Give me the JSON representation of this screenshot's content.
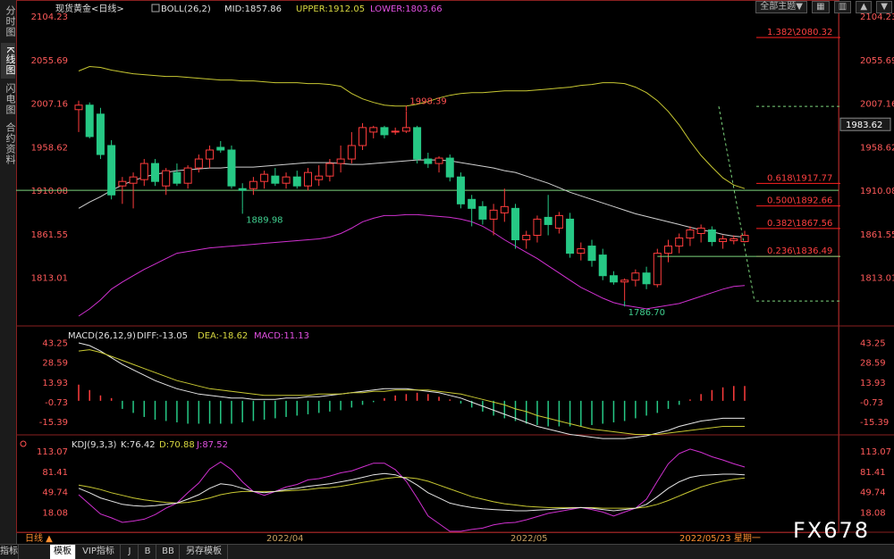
{
  "sidebar": {
    "tabs": [
      "分时图",
      "K线图",
      "闪电图",
      "合约资料"
    ],
    "active": 1
  },
  "toolbar": {
    "theme_label": "全部主题▼",
    "icons": [
      "grid-icon",
      "layout-icon",
      "chevron-up-icon",
      "chevron-down-icon"
    ]
  },
  "header": {
    "main": {
      "instrument": "现货黄金<日线>",
      "boll": "BOLL(26,2)",
      "mid": "MID:1857.86",
      "upper": "UPPER:1912.05",
      "lower": "LOWER:1803.66"
    },
    "macd": {
      "name": "MACD(26,12,9)",
      "diff": "DIFF:-13.05",
      "dea": "DEA:-18.62",
      "macd": "MACD:11.13"
    },
    "kdj": {
      "name": "KDJ(9,3,3)",
      "k": "K:76.42",
      "d": "D:70.88",
      "j": "J:87.52"
    }
  },
  "current_price": "1983.62",
  "watermark": "FX678",
  "bottom": {
    "period": "日线 ▲",
    "tabs": [
      "指标",
      "模板",
      "VIP指标",
      "J",
      "B",
      "BB",
      "另存模板"
    ],
    "active": 1
  },
  "colors": {
    "up": "#ff3c3c",
    "down": "#26c885",
    "mid": "#d0d0d0",
    "upper": "#c8c832",
    "lower": "#d030d0",
    "fib": "#ff2020",
    "hline": "#7cd47c"
  },
  "chart_data": [
    {
      "type": "candlestick",
      "title": "现货黄金<日线>",
      "y_ticks": [
        "2104.23",
        "2055.69",
        "2007.16",
        "1958.62",
        "1910.08",
        "1861.55",
        "1813.01"
      ],
      "x_ticks": [
        "2022/04",
        "2022/05",
        "2022/05/23 星期一"
      ],
      "ylim": [
        1764,
        2104.23
      ],
      "horizontal_line": 1910.08,
      "candles": [
        {
          "o": 2000,
          "h": 2010,
          "l": 1975,
          "c": 2005
        },
        {
          "o": 2005,
          "h": 2008,
          "l": 1968,
          "c": 1970
        },
        {
          "o": 1995,
          "h": 2002,
          "l": 1945,
          "c": 1950
        },
        {
          "o": 1960,
          "h": 1966,
          "l": 1900,
          "c": 1905
        },
        {
          "o": 1915,
          "h": 1925,
          "l": 1895,
          "c": 1920
        },
        {
          "o": 1918,
          "h": 1930,
          "l": 1890,
          "c": 1925
        },
        {
          "o": 1922,
          "h": 1945,
          "l": 1915,
          "c": 1940
        },
        {
          "o": 1940,
          "h": 1945,
          "l": 1915,
          "c": 1920
        },
        {
          "o": 1915,
          "h": 1935,
          "l": 1905,
          "c": 1932
        },
        {
          "o": 1930,
          "h": 1940,
          "l": 1915,
          "c": 1918
        },
        {
          "o": 1918,
          "h": 1938,
          "l": 1912,
          "c": 1935
        },
        {
          "o": 1935,
          "h": 1950,
          "l": 1930,
          "c": 1945
        },
        {
          "o": 1945,
          "h": 1960,
          "l": 1935,
          "c": 1955
        },
        {
          "o": 1958,
          "h": 1965,
          "l": 1952,
          "c": 1955
        },
        {
          "o": 1955,
          "h": 1960,
          "l": 1912,
          "c": 1915
        },
        {
          "o": 1912,
          "h": 1918,
          "l": 1890,
          "c": 1910
        },
        {
          "o": 1912,
          "h": 1925,
          "l": 1905,
          "c": 1920
        },
        {
          "o": 1920,
          "h": 1932,
          "l": 1912,
          "c": 1928
        },
        {
          "o": 1926,
          "h": 1935,
          "l": 1915,
          "c": 1918
        },
        {
          "o": 1918,
          "h": 1930,
          "l": 1912,
          "c": 1925
        },
        {
          "o": 1925,
          "h": 1932,
          "l": 1912,
          "c": 1915
        },
        {
          "o": 1915,
          "h": 1935,
          "l": 1910,
          "c": 1930
        },
        {
          "o": 1922,
          "h": 1938,
          "l": 1915,
          "c": 1926
        },
        {
          "o": 1926,
          "h": 1945,
          "l": 1920,
          "c": 1940
        },
        {
          "o": 1940,
          "h": 1960,
          "l": 1930,
          "c": 1945
        },
        {
          "o": 1945,
          "h": 1975,
          "l": 1940,
          "c": 1960
        },
        {
          "o": 1960,
          "h": 1985,
          "l": 1955,
          "c": 1980
        },
        {
          "o": 1975,
          "h": 1982,
          "l": 1968,
          "c": 1980
        },
        {
          "o": 1980,
          "h": 1982,
          "l": 1968,
          "c": 1972
        },
        {
          "o": 1975,
          "h": 1980,
          "l": 1972,
          "c": 1976
        },
        {
          "o": 1976,
          "h": 1998,
          "l": 1974,
          "c": 1980
        },
        {
          "o": 1980,
          "h": 1982,
          "l": 1940,
          "c": 1945
        },
        {
          "o": 1945,
          "h": 1952,
          "l": 1935,
          "c": 1940
        },
        {
          "o": 1940,
          "h": 1948,
          "l": 1930,
          "c": 1946
        },
        {
          "o": 1946,
          "h": 1950,
          "l": 1920,
          "c": 1925
        },
        {
          "o": 1925,
          "h": 1930,
          "l": 1890,
          "c": 1895
        },
        {
          "o": 1900,
          "h": 1905,
          "l": 1870,
          "c": 1890
        },
        {
          "o": 1892,
          "h": 1898,
          "l": 1872,
          "c": 1878
        },
        {
          "o": 1878,
          "h": 1895,
          "l": 1860,
          "c": 1888
        },
        {
          "o": 1885,
          "h": 1912,
          "l": 1875,
          "c": 1892
        },
        {
          "o": 1890,
          "h": 1895,
          "l": 1845,
          "c": 1855
        },
        {
          "o": 1855,
          "h": 1865,
          "l": 1845,
          "c": 1860
        },
        {
          "o": 1860,
          "h": 1882,
          "l": 1852,
          "c": 1878
        },
        {
          "o": 1880,
          "h": 1905,
          "l": 1860,
          "c": 1872
        },
        {
          "o": 1868,
          "h": 1886,
          "l": 1862,
          "c": 1882
        },
        {
          "o": 1878,
          "h": 1885,
          "l": 1835,
          "c": 1840
        },
        {
          "o": 1840,
          "h": 1852,
          "l": 1832,
          "c": 1845
        },
        {
          "o": 1848,
          "h": 1855,
          "l": 1825,
          "c": 1832
        },
        {
          "o": 1838,
          "h": 1845,
          "l": 1810,
          "c": 1815
        },
        {
          "o": 1815,
          "h": 1820,
          "l": 1805,
          "c": 1808
        },
        {
          "o": 1808,
          "h": 1812,
          "l": 1787,
          "c": 1810
        },
        {
          "o": 1810,
          "h": 1822,
          "l": 1803,
          "c": 1818
        },
        {
          "o": 1818,
          "h": 1825,
          "l": 1800,
          "c": 1806
        },
        {
          "o": 1805,
          "h": 1845,
          "l": 1802,
          "c": 1840
        },
        {
          "o": 1840,
          "h": 1855,
          "l": 1830,
          "c": 1848
        },
        {
          "o": 1848,
          "h": 1862,
          "l": 1840,
          "c": 1857
        },
        {
          "o": 1857,
          "h": 1870,
          "l": 1848,
          "c": 1866
        },
        {
          "o": 1862,
          "h": 1872,
          "l": 1852,
          "c": 1868
        },
        {
          "o": 1866,
          "h": 1870,
          "l": 1848,
          "c": 1853
        },
        {
          "o": 1853,
          "h": 1860,
          "l": 1845,
          "c": 1856
        },
        {
          "o": 1854,
          "h": 1860,
          "l": 1850,
          "c": 1856
        },
        {
          "o": 1853,
          "h": 1865,
          "l": 1852,
          "c": 1860
        }
      ],
      "boll": {
        "mid": [
          1890,
          1897,
          1903,
          1910,
          1916,
          1921,
          1925,
          1928,
          1930,
          1932,
          1933,
          1934,
          1935,
          1935,
          1936,
          1936,
          1936,
          1937,
          1938,
          1939,
          1940,
          1941,
          1941,
          1941,
          1940,
          1939,
          1939,
          1940,
          1941,
          1942,
          1943,
          1944,
          1944,
          1944,
          1943,
          1941,
          1939,
          1937,
          1935,
          1932,
          1930,
          1926,
          1922,
          1918,
          1913,
          1908,
          1904,
          1900,
          1896,
          1892,
          1888,
          1884,
          1881,
          1878,
          1875,
          1872,
          1869,
          1866,
          1864,
          1861,
          1859,
          1858
        ],
        "upper": [
          2043,
          2048,
          2047,
          2044,
          2042,
          2040,
          2039,
          2038,
          2037,
          2037,
          2036,
          2035,
          2034,
          2033,
          2033,
          2032,
          2032,
          2031,
          2030,
          2030,
          2030,
          2029,
          2029,
          2028,
          2026,
          2018,
          2012,
          2008,
          2005,
          2004,
          2004,
          2006,
          2009,
          2013,
          2016,
          2018,
          2019,
          2019,
          2020,
          2021,
          2021,
          2021,
          2022,
          2023,
          2024,
          2025,
          2027,
          2028,
          2030,
          2030,
          2029,
          2025,
          2019,
          2010,
          1998,
          1983,
          1965,
          1949,
          1936,
          1924,
          1916,
          1912
        ],
        "lower": [
          1770,
          1778,
          1788,
          1800,
          1808,
          1815,
          1822,
          1828,
          1834,
          1840,
          1842,
          1844,
          1846,
          1847,
          1848,
          1849,
          1850,
          1851,
          1852,
          1853,
          1854,
          1855,
          1856,
          1858,
          1862,
          1868,
          1875,
          1879,
          1882,
          1882,
          1883,
          1883,
          1882,
          1881,
          1880,
          1878,
          1875,
          1870,
          1863,
          1855,
          1848,
          1841,
          1834,
          1826,
          1818,
          1810,
          1802,
          1796,
          1790,
          1785,
          1782,
          1780,
          1778,
          1780,
          1782,
          1784,
          1788,
          1792,
          1796,
          1800,
          1803,
          1804
        ]
      },
      "price_labels": [
        {
          "text": "1998.39",
          "index": 30,
          "value": 1998.39,
          "kind": "high"
        },
        {
          "text": "1889.98",
          "index": 15,
          "value": 1889.98,
          "kind": "low"
        },
        {
          "text": "1786.70",
          "index": 50,
          "value": 1786.7,
          "kind": "low"
        }
      ],
      "fibonacci": {
        "labels": [
          "1.382\\2080.32",
          "0.618\\1917.77",
          "0.500\\1892.66",
          "0.382\\1867.56",
          "0.236\\1836.49"
        ],
        "values": [
          2080.32,
          1917.77,
          1892.66,
          1867.56,
          1836.49
        ],
        "base_levels": [
          2003.65,
          1786.7
        ],
        "support_line": 1836.49
      }
    },
    {
      "type": "bar",
      "title": "MACD(26,12,9)",
      "y_ticks": [
        "43.25",
        "28.59",
        "13.93",
        "-0.73",
        "-15.39"
      ],
      "ylim": [
        -20,
        45
      ],
      "histogram": [
        12,
        8,
        4,
        2,
        -6,
        -9,
        -12,
        -14,
        -15,
        -16,
        -17,
        -17,
        -17,
        -17,
        -17,
        -16,
        -15,
        -14,
        -13,
        -12,
        -11,
        -10,
        -9,
        -8,
        -7,
        -5,
        -3,
        -1,
        2,
        4,
        5,
        6,
        5,
        3,
        1,
        -2,
        -5,
        -8,
        -11,
        -13,
        -15,
        -17,
        -18,
        -19,
        -19,
        -19,
        -19,
        -18,
        -17,
        -16,
        -15,
        -13,
        -11,
        -9,
        -6,
        -3,
        1,
        5,
        8,
        10,
        11,
        11
      ],
      "diff": [
        43,
        41,
        37,
        32,
        27,
        23,
        19,
        15,
        12,
        9,
        7,
        5,
        4,
        3,
        2,
        2,
        1,
        1,
        1,
        2,
        2,
        3,
        3,
        4,
        5,
        6,
        7,
        8,
        9,
        9,
        9,
        8,
        7,
        6,
        4,
        2,
        -1,
        -4,
        -7,
        -10,
        -13,
        -16,
        -19,
        -21,
        -23,
        -25,
        -26,
        -27,
        -28,
        -28,
        -28,
        -27,
        -26,
        -24,
        -22,
        -19,
        -17,
        -15,
        -14,
        -13,
        -13,
        -13
      ],
      "dea": [
        37,
        38,
        36,
        33,
        30,
        27,
        24,
        21,
        18,
        15,
        13,
        11,
        9,
        8,
        7,
        6,
        5,
        4,
        4,
        4,
        4,
        4,
        5,
        5,
        5,
        6,
        6,
        7,
        7,
        8,
        8,
        8,
        8,
        7,
        6,
        5,
        3,
        1,
        -1,
        -3,
        -6,
        -8,
        -11,
        -13,
        -15,
        -17,
        -19,
        -21,
        -22,
        -23,
        -24,
        -25,
        -25,
        -25,
        -24,
        -23,
        -22,
        -21,
        -20,
        -19,
        -19,
        -19
      ]
    },
    {
      "type": "line",
      "title": "KDJ(9,3,3)",
      "y_ticks": [
        "113.07",
        "81.41",
        "49.74",
        "18.08"
      ],
      "ylim": [
        -5,
        120
      ],
      "k": [
        55,
        48,
        40,
        35,
        30,
        28,
        27,
        28,
        30,
        32,
        38,
        45,
        55,
        62,
        60,
        55,
        50,
        48,
        50,
        53,
        55,
        58,
        60,
        62,
        65,
        68,
        72,
        76,
        78,
        76,
        70,
        60,
        48,
        40,
        32,
        28,
        25,
        23,
        22,
        21,
        20,
        20,
        21,
        22,
        23,
        24,
        25,
        24,
        22,
        20,
        22,
        24,
        30,
        42,
        55,
        65,
        72,
        75,
        76,
        77,
        77,
        76
      ],
      "d": [
        60,
        57,
        53,
        48,
        44,
        40,
        37,
        35,
        33,
        32,
        33,
        36,
        40,
        45,
        48,
        50,
        50,
        50,
        50,
        51,
        52,
        53,
        55,
        56,
        58,
        61,
        64,
        67,
        70,
        72,
        72,
        70,
        66,
        60,
        54,
        48,
        42,
        38,
        34,
        31,
        29,
        27,
        26,
        25,
        25,
        25,
        25,
        25,
        24,
        24,
        24,
        24,
        26,
        30,
        36,
        43,
        50,
        57,
        62,
        66,
        69,
        71
      ],
      "j": [
        45,
        30,
        15,
        9,
        2,
        4,
        7,
        14,
        24,
        32,
        48,
        63,
        85,
        96,
        84,
        65,
        50,
        44,
        50,
        57,
        61,
        68,
        70,
        74,
        79,
        82,
        88,
        94,
        94,
        84,
        66,
        40,
        12,
        0,
        -12,
        -12,
        -9,
        -7,
        -2,
        1,
        2,
        6,
        11,
        16,
        19,
        22,
        25,
        22,
        18,
        12,
        18,
        24,
        38,
        66,
        93,
        109,
        116,
        111,
        104,
        99,
        93,
        88
      ]
    }
  ]
}
